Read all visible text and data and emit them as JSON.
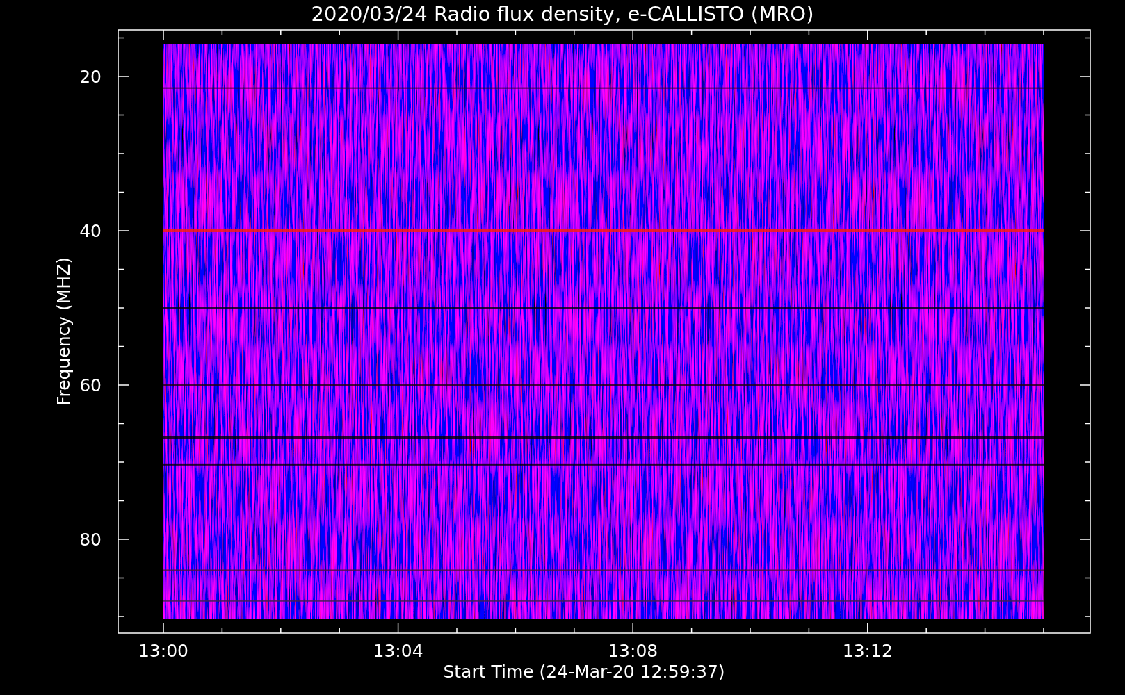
{
  "plot": {
    "title": "2020/03/24  Radio flux density, e-CALLISTO (MRO)",
    "xlabel": "Start Time (24-Mar-20 12:59:37)",
    "ylabel": "Frequency (MHZ)",
    "xticks": [
      "13:00",
      "13:04",
      "13:08",
      "13:12"
    ],
    "yticks": [
      "20",
      "40",
      "60",
      "80"
    ]
  }
}
